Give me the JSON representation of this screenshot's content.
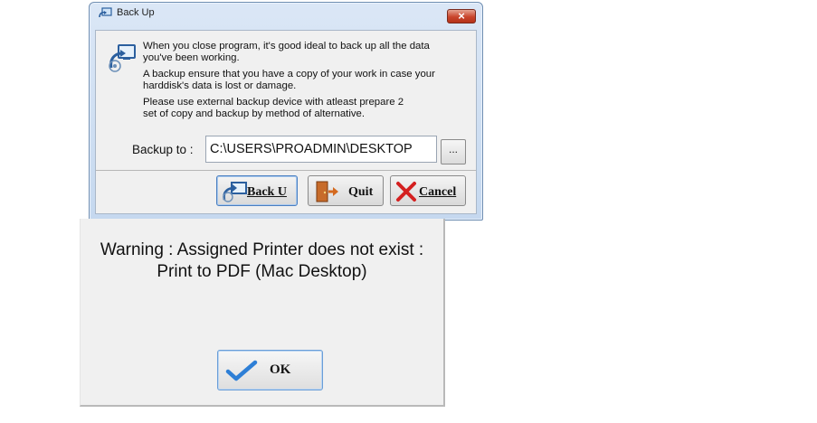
{
  "backup_dialog": {
    "title": "Back Up",
    "close_label": "×",
    "message": {
      "line1": "When you close program, it's good ideal to back up all the data",
      "line2": "you've been working.",
      "line3": "A backup ensure that you have a copy of your work in case your",
      "line4": "harddisk's data is lost or damage.",
      "line5": "Please use external backup device with atleast prepare 2",
      "line6": "set of copy and backup by method of alternative."
    },
    "backup_to_label": "Backup to :",
    "backup_path_value": "C:\\USERS\\PROADMIN\\DESKTOP",
    "browse_label": "...",
    "buttons": {
      "backup": "Back U",
      "quit": "Quit",
      "cancel": "Cancel"
    },
    "icons": [
      "backup-icon",
      "door-exit-icon",
      "red-x-icon"
    ]
  },
  "warning_dialog": {
    "line1": "Warning : Assigned Printer does not exist :",
    "line2": "Print to PDF (Mac Desktop)",
    "ok_label": "OK",
    "ok_icon": "checkmark-icon",
    "check_color": "#2e7fd6"
  }
}
